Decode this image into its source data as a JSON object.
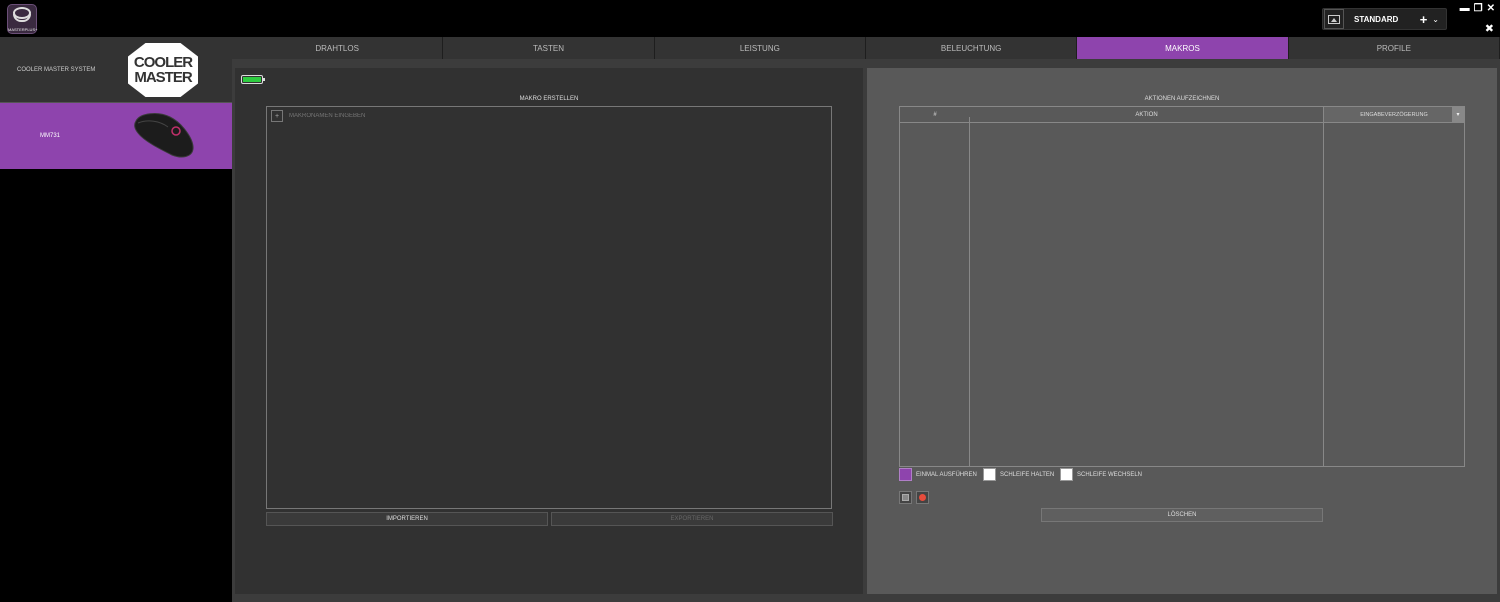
{
  "app": {
    "logo_text": "MASTERPLUS+"
  },
  "profile": {
    "name": "STANDARD",
    "add_symbol": "+",
    "chevron": "⌄"
  },
  "window_controls": {
    "minimize": "▬",
    "restore": "❐",
    "close": "✕",
    "settings": "✖"
  },
  "sidebar": {
    "system_label": "COOLER MASTER SYSTEM",
    "logo_line1": "COOLER",
    "logo_line2": "MASTER",
    "device_label": "MM731"
  },
  "tabs": [
    {
      "label": "DRAHTLOS"
    },
    {
      "label": "TASTEN"
    },
    {
      "label": "LEISTUNG"
    },
    {
      "label": "BELEUCHTUNG"
    },
    {
      "label": "MAKROS"
    },
    {
      "label": "PROFILE"
    }
  ],
  "battery": {
    "level_percent": 100,
    "color": "#2ecc40"
  },
  "macro": {
    "title": "MAKRO ERSTELLEN",
    "add_symbol": "+",
    "name_placeholder": "MAKRONAMEN EINGEBEN",
    "import_label": "IMPORTIEREN",
    "export_label": "EXPORTIEREN"
  },
  "recorder": {
    "title": "AKTIONEN AUFZEICHNEN",
    "columns": {
      "hash": "#",
      "action": "AKTION",
      "delay": "EINGABEVERZÖGERUNG"
    },
    "dropdown_symbol": "▾",
    "options": [
      {
        "label": "EINMAL AUSFÜHREN",
        "selected": true
      },
      {
        "label": "SCHLEIFE HALTEN",
        "selected": false
      },
      {
        "label": "SCHLEIFE WECHSELN",
        "selected": false
      }
    ],
    "delete_label": "LÖSCHEN"
  },
  "colors": {
    "accent": "#8e44ad"
  }
}
